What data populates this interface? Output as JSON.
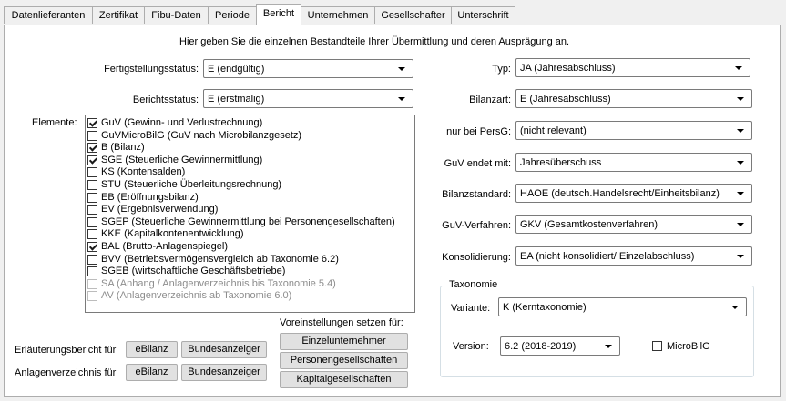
{
  "tabs": [
    {
      "label": "Datenlieferanten",
      "active": false
    },
    {
      "label": "Zertifikat",
      "active": false
    },
    {
      "label": "Fibu-Daten",
      "active": false
    },
    {
      "label": "Periode",
      "active": false
    },
    {
      "label": "Bericht",
      "active": true
    },
    {
      "label": "Unternehmen",
      "active": false
    },
    {
      "label": "Gesellschafter",
      "active": false
    },
    {
      "label": "Unterschrift",
      "active": false
    }
  ],
  "intro_text": "Hier geben Sie die einzelnen Bestandteile Ihrer Übermittlung und deren Ausprägung an.",
  "left": {
    "fertigstellung_label": "Fertigstellungsstatus:",
    "fertigstellung_value": "E (endgültig)",
    "berichtsstatus_label": "Berichtsstatus:",
    "berichtsstatus_value": "E (erstmalig)",
    "elemente_label": "Elemente:",
    "elemente": [
      {
        "label": "GuV (Gewinn- und Verlustrechnung)",
        "checked": true,
        "enabled": true
      },
      {
        "label": "GuVMicroBilG (GuV nach Microbilanzgesetz)",
        "checked": false,
        "enabled": true
      },
      {
        "label": "B (Bilanz)",
        "checked": true,
        "enabled": true
      },
      {
        "label": "SGE (Steuerliche Gewinnermittlung)",
        "checked": true,
        "enabled": true
      },
      {
        "label": "KS (Kontensalden)",
        "checked": false,
        "enabled": true
      },
      {
        "label": "STU (Steuerliche Überleitungsrechnung)",
        "checked": false,
        "enabled": true
      },
      {
        "label": "EB (Eröffnungsbilanz)",
        "checked": false,
        "enabled": true
      },
      {
        "label": "EV (Ergebnisverwendung)",
        "checked": false,
        "enabled": true
      },
      {
        "label": "SGEP (Steuerliche Gewinnermittlung bei Personengesellschaften)",
        "checked": false,
        "enabled": true
      },
      {
        "label": "KKE (Kapitalkontenentwicklung)",
        "checked": false,
        "enabled": true
      },
      {
        "label": "BAL (Brutto-Anlagenspiegel)",
        "checked": true,
        "enabled": true
      },
      {
        "label": "BVV (Betriebsvermögensvergleich ab Taxonomie 6.2)",
        "checked": false,
        "enabled": true
      },
      {
        "label": "SGEB (wirtschaftliche Geschäftsbetriebe)",
        "checked": false,
        "enabled": true
      },
      {
        "label": "SA (Anhang / Anlagenverzeichnis bis Taxonomie 5.4)",
        "checked": false,
        "enabled": false
      },
      {
        "label": "AV (Anlagenverzeichnis ab Taxonomie 6.0)",
        "checked": false,
        "enabled": false
      }
    ],
    "voreinstellungen_label": "Voreinstellungen setzen für:",
    "preset_buttons": [
      "Einzelunternehmer",
      "Personengesellschaften",
      "Kapitalgesellschaften"
    ],
    "erlaeuterung_label": "Erläuterungsbericht für",
    "anlagen_label": "Anlagenverzeichnis für",
    "ebilanz_label": "eBilanz",
    "bundesanzeiger_label": "Bundesanzeiger"
  },
  "right": {
    "typ_label": "Typ:",
    "typ_value": "JA (Jahresabschluss)",
    "bilanzart_label": "Bilanzart:",
    "bilanzart_value": "E (Jahresabschluss)",
    "persg_label": "nur bei PersG:",
    "persg_value": "(nicht relevant)",
    "guv_endet_label": "GuV endet mit:",
    "guv_endet_value": "Jahresüberschuss",
    "bilanzstandard_label": "Bilanzstandard:",
    "bilanzstandard_value": "HAOE (deutsch.Handelsrecht/Einheitsbilanz)",
    "guv_verfahren_label": "GuV-Verfahren:",
    "guv_verfahren_value": "GKV (Gesamtkostenverfahren)",
    "konsolidierung_label": "Konsolidierung:",
    "konsolidierung_value": "EA (nicht konsolidiert/ Einzelabschluss)",
    "taxonomie_title": "Taxonomie",
    "variante_label": "Variante:",
    "variante_value": "K (Kerntaxonomie)",
    "version_label": "Version:",
    "version_value": "6.2 (2018-2019)",
    "microbilg_label": "MicroBilG",
    "microbilg_checked": false
  }
}
